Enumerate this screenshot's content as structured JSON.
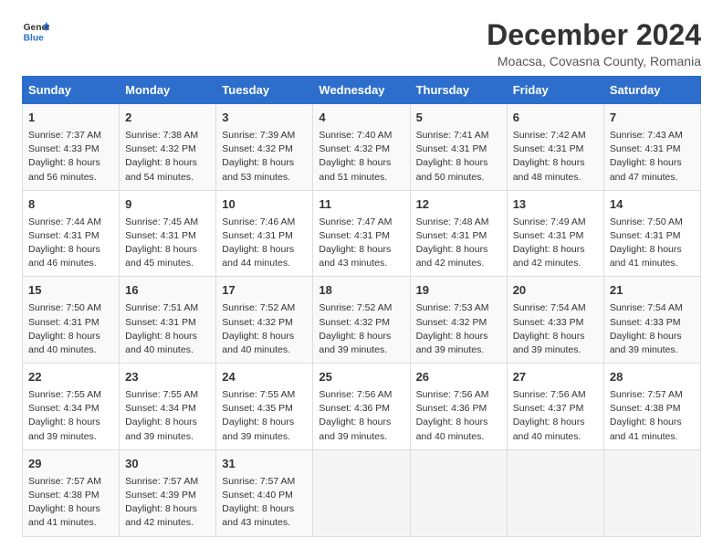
{
  "header": {
    "logo_general": "General",
    "logo_blue": "Blue",
    "title": "December 2024",
    "subtitle": "Moacsa, Covasna County, Romania"
  },
  "weekdays": [
    "Sunday",
    "Monday",
    "Tuesday",
    "Wednesday",
    "Thursday",
    "Friday",
    "Saturday"
  ],
  "weeks": [
    [
      {
        "day": "1",
        "sunrise": "Sunrise: 7:37 AM",
        "sunset": "Sunset: 4:33 PM",
        "daylight": "Daylight: 8 hours and 56 minutes."
      },
      {
        "day": "2",
        "sunrise": "Sunrise: 7:38 AM",
        "sunset": "Sunset: 4:32 PM",
        "daylight": "Daylight: 8 hours and 54 minutes."
      },
      {
        "day": "3",
        "sunrise": "Sunrise: 7:39 AM",
        "sunset": "Sunset: 4:32 PM",
        "daylight": "Daylight: 8 hours and 53 minutes."
      },
      {
        "day": "4",
        "sunrise": "Sunrise: 7:40 AM",
        "sunset": "Sunset: 4:32 PM",
        "daylight": "Daylight: 8 hours and 51 minutes."
      },
      {
        "day": "5",
        "sunrise": "Sunrise: 7:41 AM",
        "sunset": "Sunset: 4:31 PM",
        "daylight": "Daylight: 8 hours and 50 minutes."
      },
      {
        "day": "6",
        "sunrise": "Sunrise: 7:42 AM",
        "sunset": "Sunset: 4:31 PM",
        "daylight": "Daylight: 8 hours and 48 minutes."
      },
      {
        "day": "7",
        "sunrise": "Sunrise: 7:43 AM",
        "sunset": "Sunset: 4:31 PM",
        "daylight": "Daylight: 8 hours and 47 minutes."
      }
    ],
    [
      {
        "day": "8",
        "sunrise": "Sunrise: 7:44 AM",
        "sunset": "Sunset: 4:31 PM",
        "daylight": "Daylight: 8 hours and 46 minutes."
      },
      {
        "day": "9",
        "sunrise": "Sunrise: 7:45 AM",
        "sunset": "Sunset: 4:31 PM",
        "daylight": "Daylight: 8 hours and 45 minutes."
      },
      {
        "day": "10",
        "sunrise": "Sunrise: 7:46 AM",
        "sunset": "Sunset: 4:31 PM",
        "daylight": "Daylight: 8 hours and 44 minutes."
      },
      {
        "day": "11",
        "sunrise": "Sunrise: 7:47 AM",
        "sunset": "Sunset: 4:31 PM",
        "daylight": "Daylight: 8 hours and 43 minutes."
      },
      {
        "day": "12",
        "sunrise": "Sunrise: 7:48 AM",
        "sunset": "Sunset: 4:31 PM",
        "daylight": "Daylight: 8 hours and 42 minutes."
      },
      {
        "day": "13",
        "sunrise": "Sunrise: 7:49 AM",
        "sunset": "Sunset: 4:31 PM",
        "daylight": "Daylight: 8 hours and 42 minutes."
      },
      {
        "day": "14",
        "sunrise": "Sunrise: 7:50 AM",
        "sunset": "Sunset: 4:31 PM",
        "daylight": "Daylight: 8 hours and 41 minutes."
      }
    ],
    [
      {
        "day": "15",
        "sunrise": "Sunrise: 7:50 AM",
        "sunset": "Sunset: 4:31 PM",
        "daylight": "Daylight: 8 hours and 40 minutes."
      },
      {
        "day": "16",
        "sunrise": "Sunrise: 7:51 AM",
        "sunset": "Sunset: 4:31 PM",
        "daylight": "Daylight: 8 hours and 40 minutes."
      },
      {
        "day": "17",
        "sunrise": "Sunrise: 7:52 AM",
        "sunset": "Sunset: 4:32 PM",
        "daylight": "Daylight: 8 hours and 40 minutes."
      },
      {
        "day": "18",
        "sunrise": "Sunrise: 7:52 AM",
        "sunset": "Sunset: 4:32 PM",
        "daylight": "Daylight: 8 hours and 39 minutes."
      },
      {
        "day": "19",
        "sunrise": "Sunrise: 7:53 AM",
        "sunset": "Sunset: 4:32 PM",
        "daylight": "Daylight: 8 hours and 39 minutes."
      },
      {
        "day": "20",
        "sunrise": "Sunrise: 7:54 AM",
        "sunset": "Sunset: 4:33 PM",
        "daylight": "Daylight: 8 hours and 39 minutes."
      },
      {
        "day": "21",
        "sunrise": "Sunrise: 7:54 AM",
        "sunset": "Sunset: 4:33 PM",
        "daylight": "Daylight: 8 hours and 39 minutes."
      }
    ],
    [
      {
        "day": "22",
        "sunrise": "Sunrise: 7:55 AM",
        "sunset": "Sunset: 4:34 PM",
        "daylight": "Daylight: 8 hours and 39 minutes."
      },
      {
        "day": "23",
        "sunrise": "Sunrise: 7:55 AM",
        "sunset": "Sunset: 4:34 PM",
        "daylight": "Daylight: 8 hours and 39 minutes."
      },
      {
        "day": "24",
        "sunrise": "Sunrise: 7:55 AM",
        "sunset": "Sunset: 4:35 PM",
        "daylight": "Daylight: 8 hours and 39 minutes."
      },
      {
        "day": "25",
        "sunrise": "Sunrise: 7:56 AM",
        "sunset": "Sunset: 4:36 PM",
        "daylight": "Daylight: 8 hours and 39 minutes."
      },
      {
        "day": "26",
        "sunrise": "Sunrise: 7:56 AM",
        "sunset": "Sunset: 4:36 PM",
        "daylight": "Daylight: 8 hours and 40 minutes."
      },
      {
        "day": "27",
        "sunrise": "Sunrise: 7:56 AM",
        "sunset": "Sunset: 4:37 PM",
        "daylight": "Daylight: 8 hours and 40 minutes."
      },
      {
        "day": "28",
        "sunrise": "Sunrise: 7:57 AM",
        "sunset": "Sunset: 4:38 PM",
        "daylight": "Daylight: 8 hours and 41 minutes."
      }
    ],
    [
      {
        "day": "29",
        "sunrise": "Sunrise: 7:57 AM",
        "sunset": "Sunset: 4:38 PM",
        "daylight": "Daylight: 8 hours and 41 minutes."
      },
      {
        "day": "30",
        "sunrise": "Sunrise: 7:57 AM",
        "sunset": "Sunset: 4:39 PM",
        "daylight": "Daylight: 8 hours and 42 minutes."
      },
      {
        "day": "31",
        "sunrise": "Sunrise: 7:57 AM",
        "sunset": "Sunset: 4:40 PM",
        "daylight": "Daylight: 8 hours and 43 minutes."
      },
      null,
      null,
      null,
      null
    ]
  ]
}
